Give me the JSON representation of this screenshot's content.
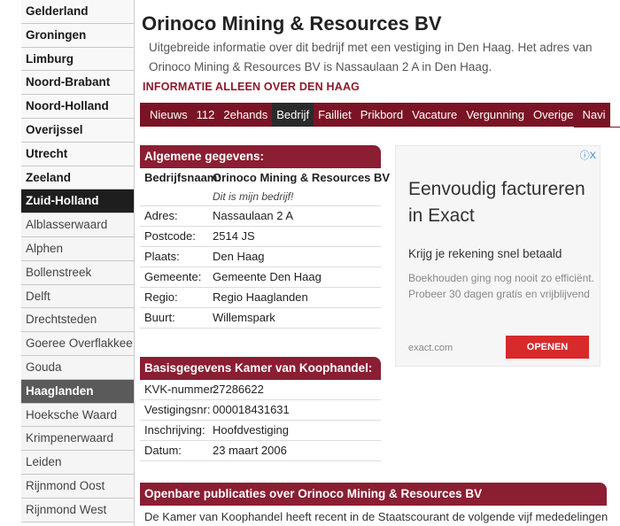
{
  "sidebar": {
    "provinces": [
      {
        "label": "Gelderland"
      },
      {
        "label": "Groningen"
      },
      {
        "label": "Limburg"
      },
      {
        "label": "Noord-Brabant"
      },
      {
        "label": "Noord-Holland"
      },
      {
        "label": "Overijssel"
      },
      {
        "label": "Utrecht"
      },
      {
        "label": "Zeeland"
      },
      {
        "label": "Zuid-Holland"
      }
    ],
    "regions": [
      {
        "label": "Alblasserwaard"
      },
      {
        "label": "Alphen"
      },
      {
        "label": "Bollenstreek"
      },
      {
        "label": "Delft"
      },
      {
        "label": "Drechtsteden"
      },
      {
        "label": "Goeree Overflakkee"
      },
      {
        "label": "Gouda"
      },
      {
        "label": "Haaglanden"
      },
      {
        "label": "Hoeksche Waard"
      },
      {
        "label": "Krimpenerwaard"
      },
      {
        "label": "Leiden"
      },
      {
        "label": "Rijnmond Oost"
      },
      {
        "label": "Rijnmond West"
      }
    ]
  },
  "page": {
    "title": "Orinoco Mining & Resources BV",
    "intro": "Uitgebreide informatie over dit bedrijf met een vestiging in Den Haag. Het adres van Orinoco Mining & Resources BV is Nassaulaan 2 A in Den Haag.",
    "info_label": "INFORMATIE ALLEEN OVER DEN HAAG"
  },
  "nav": [
    "Nieuws",
    "112",
    "2ehands",
    "Bedrijf",
    "Failliet",
    "Prikbord",
    "Vacature",
    "Vergunning",
    "Overige",
    "Navi"
  ],
  "general": {
    "heading": "Algemene gegevens:",
    "name_label": "Bedrijfsnaam:",
    "name_value": "Orinoco Mining & Resources BV",
    "claim": "Dit is mijn bedrijf!",
    "rows": [
      {
        "k": "Adres:",
        "v": "Nassaulaan 2 A"
      },
      {
        "k": "Postcode:",
        "v": "2514 JS"
      },
      {
        "k": "Plaats:",
        "v": "Den Haag"
      },
      {
        "k": "Gemeente:",
        "v": "Gemeente Den Haag"
      },
      {
        "k": "Regio:",
        "v": "Regio Haaglanden"
      },
      {
        "k": "Buurt:",
        "v": "Willemspark"
      }
    ]
  },
  "kvk": {
    "heading": "Basisgegevens Kamer van Koophandel:",
    "rows": [
      {
        "k": "KVK-nummer:",
        "v": "27286622"
      },
      {
        "k": "Vestigingsnr:",
        "v": "000018431631"
      },
      {
        "k": "Inschrijving:",
        "v": "Hoofdvestiging"
      },
      {
        "k": "Datum:",
        "v": "23 maart 2006"
      }
    ]
  },
  "ad": {
    "choices": "ⓘX",
    "title": "Eenvoudig factureren in Exact",
    "subtitle": "Krijg je rekening snel betaald",
    "description": "Boekhouden ging nog nooit zo efficiënt. Probeer 30 dagen gratis en vrijblijvend",
    "domain": "exact.com",
    "button": "OPENEN"
  },
  "publications": {
    "heading": "Openbare publicaties over Orinoco Mining & Resources BV",
    "text": "De Kamer van Koophandel heeft recent in de Staatscourant de volgende vijf mededelingen"
  },
  "colors": {
    "brand": "#8b1e33",
    "navbar": "#7a1425",
    "active_dark": "#1e1e1e",
    "ad_button": "#d82a2a"
  }
}
